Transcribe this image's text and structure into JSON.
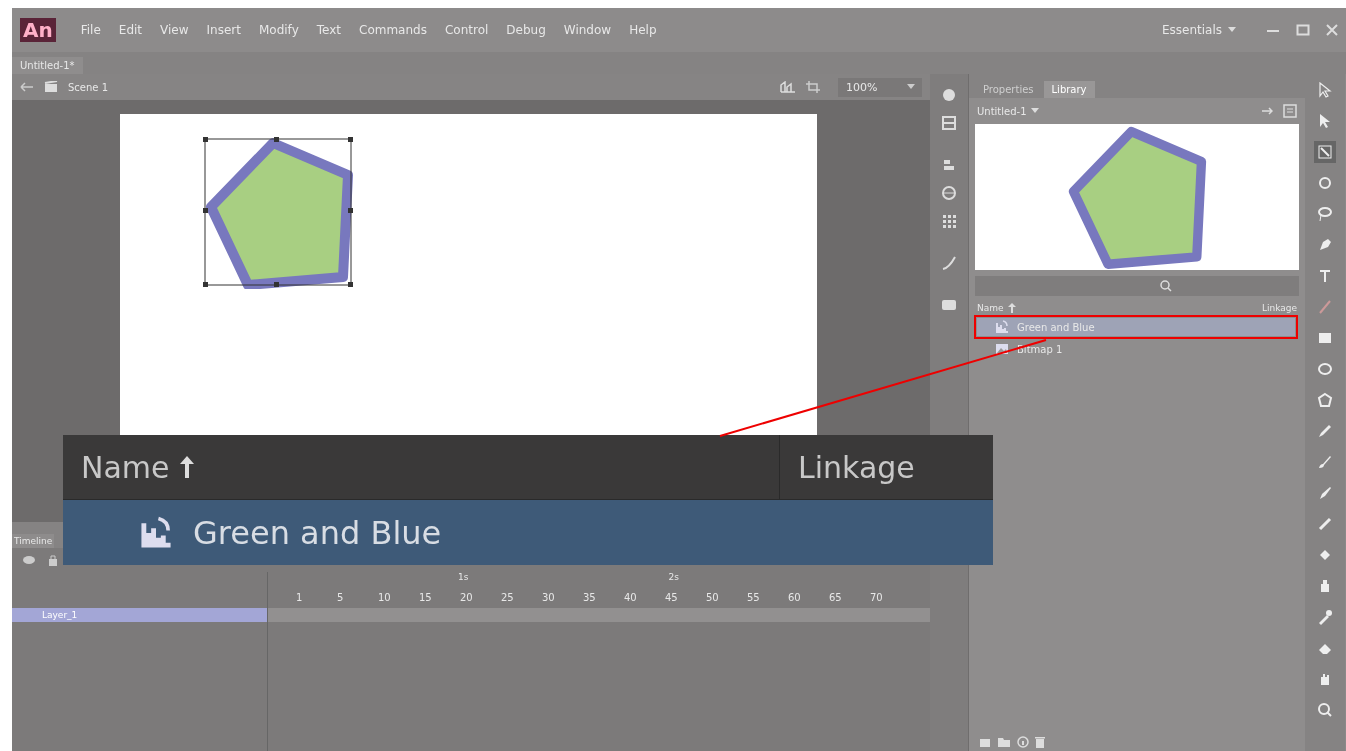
{
  "app": {
    "logo": "An",
    "menu": [
      "File",
      "Edit",
      "View",
      "Insert",
      "Modify",
      "Text",
      "Commands",
      "Control",
      "Debug",
      "Window",
      "Help"
    ],
    "workspace": "Essentials"
  },
  "document_tab": "Untitled-1*",
  "edit_bar": {
    "scene": "Scene 1",
    "zoom": "100%"
  },
  "library_panel": {
    "tabs": [
      {
        "label": "Properties",
        "selected": false
      },
      {
        "label": "Library",
        "selected": true
      }
    ],
    "document": "Untitled-1",
    "columns": [
      "Name",
      "Linkage"
    ],
    "items": [
      {
        "name": "Green and Blue",
        "kind": "graphic",
        "selected": true,
        "highlighted": true
      },
      {
        "name": "Bitmap 1",
        "kind": "bitmap",
        "selected": false,
        "highlighted": false
      }
    ]
  },
  "callout": {
    "columns": [
      "Name",
      "Linkage"
    ],
    "item": {
      "name": "Green and Blue",
      "selected": true
    }
  },
  "timeline": {
    "title": "Timeline",
    "seconds": [
      "1s",
      "2s"
    ],
    "frames": [
      "1",
      "5",
      "10",
      "15",
      "20",
      "25",
      "30",
      "35",
      "40",
      "45",
      "50",
      "55",
      "60",
      "65",
      "70"
    ],
    "layers": [
      {
        "name": "Layer_1",
        "selected": true
      }
    ]
  }
}
